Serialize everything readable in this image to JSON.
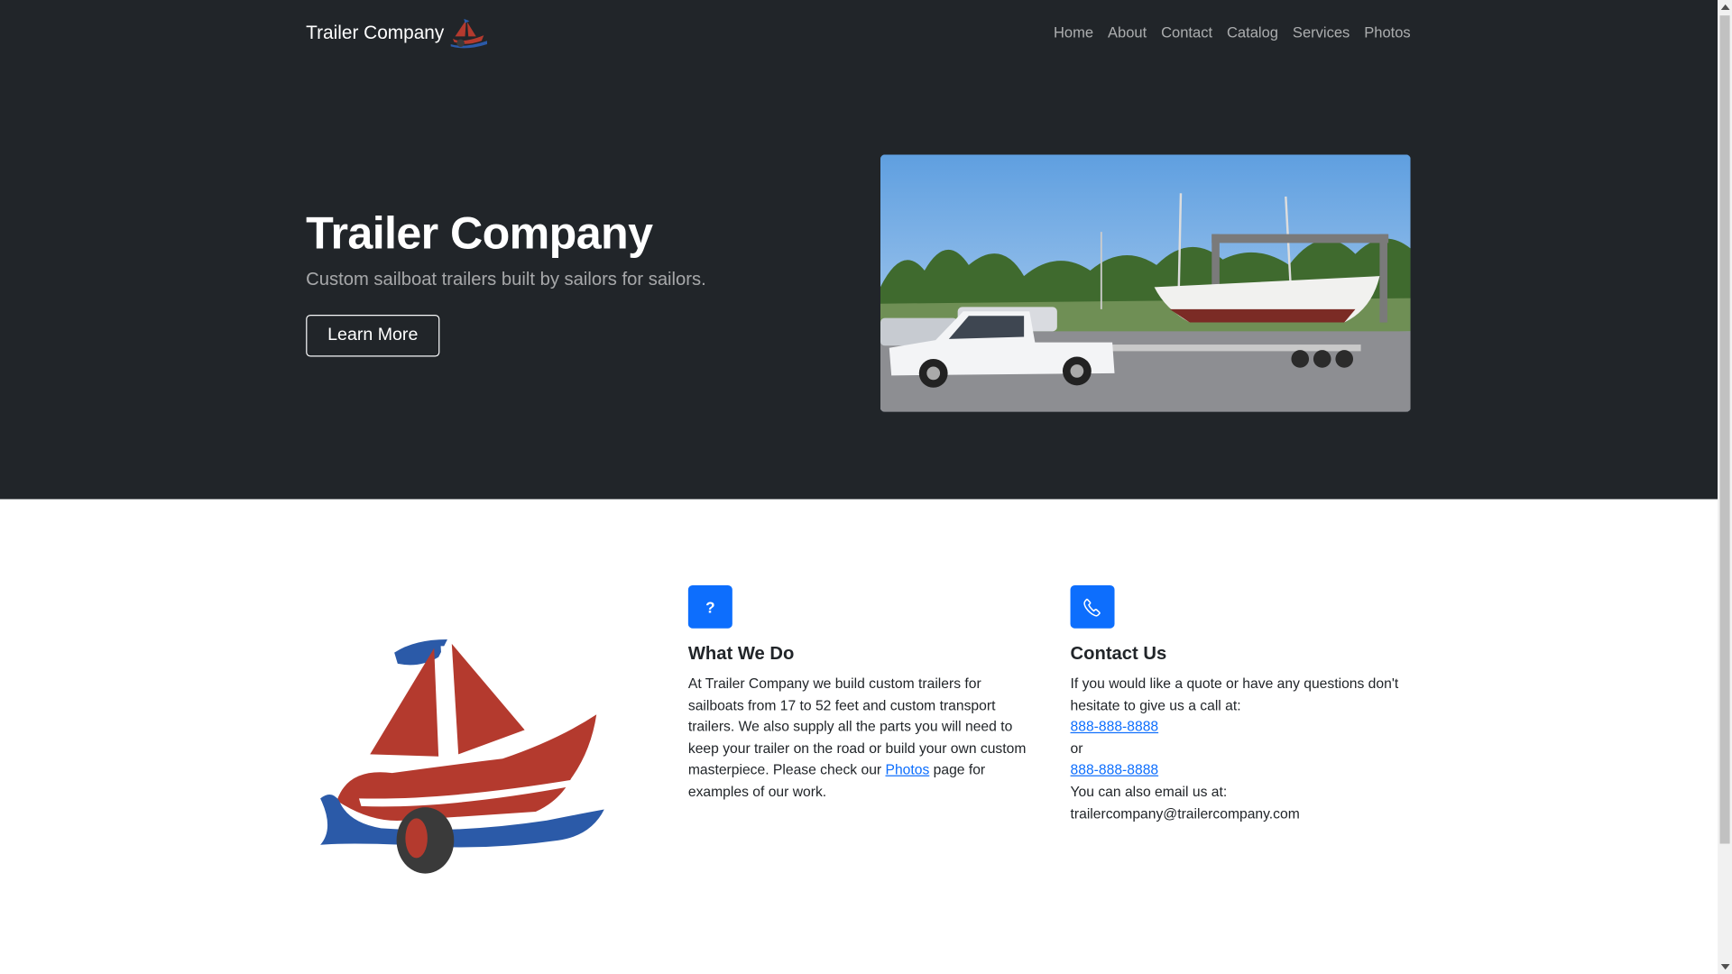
{
  "nav": {
    "brand": "Trailer Company",
    "items": [
      "Home",
      "About",
      "Contact",
      "Catalog",
      "Services",
      "Photos"
    ]
  },
  "hero": {
    "title": "Trailer Company",
    "subtitle": "Custom sailboat trailers built by sailors for sailors.",
    "button": "Learn More",
    "image_icon": "sailboat-on-trailer-photo"
  },
  "features": {
    "what": {
      "icon_glyph": "?",
      "title": "What We Do",
      "text_before": "At Trailer Company we build custom trailers for sailboats from 17 to 52 feet and custom transport trailers. We also supply all the parts you will need to keep your trailer on the road or build your own custom masterpiece. Please check our ",
      "link": "Photos",
      "text_after": " page for examples of our work."
    },
    "contact": {
      "icon": "phone-icon",
      "title": "Contact Us",
      "line1": "If you would like a quote or have any questions don't hesitate to give us a call at:",
      "phone1": "888-888-8888",
      "or": "or",
      "phone2": "888-888-8888",
      "email_label": "You can also email us at:",
      "email": "trailercompany@trailercompany.com"
    }
  },
  "colors": {
    "hero_bg": "#212529",
    "accent": "#0d6efd",
    "logo_red": "#b43a2e",
    "logo_blue": "#2b5aa8"
  }
}
